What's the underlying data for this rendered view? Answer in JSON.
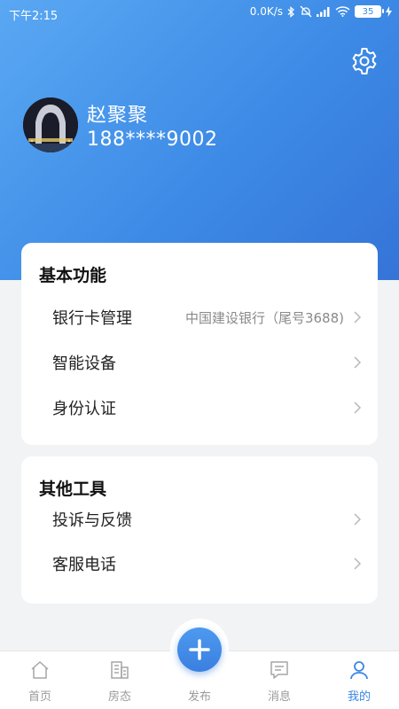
{
  "status_bar": {
    "time": "下午2:15",
    "net_speed": "0.0K/s",
    "battery": "35",
    "icons": [
      "bluetooth-icon",
      "mute-icon",
      "signal-icon",
      "wifi-icon",
      "charging-icon"
    ]
  },
  "header": {
    "settings_icon": "gear-icon",
    "gradient_colors": [
      "#5aa8f3",
      "#3574d8"
    ]
  },
  "profile": {
    "name": "赵聚聚",
    "phone": "188****9002"
  },
  "basic_section": {
    "title": "基本功能",
    "items": [
      {
        "label": "银行卡管理",
        "value": "中国建设银行（尾号3688)"
      },
      {
        "label": "智能设备",
        "value": ""
      },
      {
        "label": "身份认证",
        "value": ""
      }
    ]
  },
  "other_section": {
    "title": "其他工具",
    "items": [
      {
        "label": "投诉与反馈"
      },
      {
        "label": "客服电话"
      }
    ]
  },
  "tab_bar": {
    "accent": "#3a86e6",
    "tabs": [
      {
        "label": "首页",
        "icon": "home-icon"
      },
      {
        "label": "房态",
        "icon": "building-icon"
      },
      {
        "label": "发布",
        "icon": "plus-icon"
      },
      {
        "label": "消息",
        "icon": "message-icon"
      },
      {
        "label": "我的",
        "icon": "person-icon",
        "active": true
      }
    ]
  }
}
